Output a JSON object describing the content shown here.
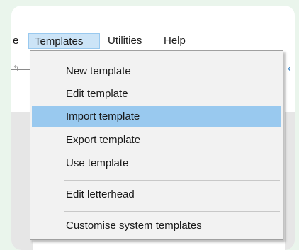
{
  "menubar": {
    "items": [
      {
        "label": "e",
        "active": false
      },
      {
        "label": "Templates",
        "active": true
      },
      {
        "label": "Utilities",
        "active": false
      },
      {
        "label": "Help",
        "active": false
      }
    ]
  },
  "templates_menu": {
    "items": [
      {
        "label": "New template"
      },
      {
        "label": "Edit template"
      },
      {
        "label": "Import template",
        "highlighted": true
      },
      {
        "label": "Export template"
      },
      {
        "label": "Use template"
      },
      {
        "label": "Edit letterhead"
      },
      {
        "label": "Customise system templates"
      }
    ]
  },
  "colors": {
    "background": "#eaf5ec",
    "highlight": "#99c9ef",
    "active_menubar": "#cce4f7"
  }
}
